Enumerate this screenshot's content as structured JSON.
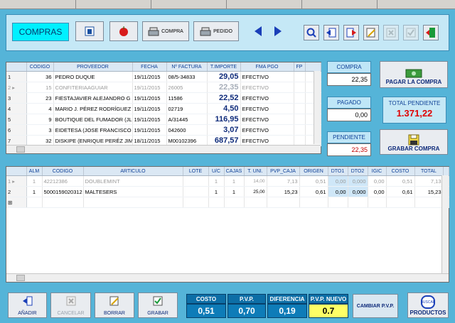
{
  "title": "COMPRAS",
  "toolbar": {
    "compra_label": "COMPRA",
    "pedido_label": "PEDIDO"
  },
  "purchases": {
    "headers": [
      "",
      "CODIGO",
      "PROVEEDOR",
      "FECHA",
      "Nº FACTURA",
      "T.IMPORTE",
      "FMA PGO",
      "FP"
    ],
    "rows": [
      {
        "n": "1",
        "codigo": "36",
        "proveedor": "PEDRO DUQUE",
        "fecha": "19/11/2015",
        "factura": "08/5-34833",
        "importe": "29,05",
        "pago": "EFECTIVO"
      },
      {
        "n": "2",
        "codigo": "15",
        "proveedor": "CONFITERIAAGUIAR",
        "fecha": "19/11/2015",
        "factura": "26005",
        "importe": "22,35",
        "pago": "EFECTIVO"
      },
      {
        "n": "3",
        "codigo": "23",
        "proveedor": "FIESTAJAVIER ALEJANDRO G",
        "fecha": "19/11/2015",
        "factura": "11586",
        "importe": "22,52",
        "pago": "EFECTIVO"
      },
      {
        "n": "4",
        "codigo": "4",
        "proveedor": "MARIO J. PÉREZ RODRÍGUEZ",
        "fecha": "19/11/2015",
        "factura": "02719",
        "importe": "4,50",
        "pago": "EFECTIVO"
      },
      {
        "n": "5",
        "codigo": "9",
        "proveedor": "BOUTIQUE DEL FUMADOR (JL",
        "fecha": "19/11/2015",
        "factura": "A/31445",
        "importe": "116,95",
        "pago": "EFECTIVO"
      },
      {
        "n": "6",
        "codigo": "3",
        "proveedor": "EIDETESA (JOSE FRANCISCO",
        "fecha": "19/11/2015",
        "factura": "042600",
        "importe": "3,07",
        "pago": "EFECTIVO"
      },
      {
        "n": "7",
        "codigo": "32",
        "proveedor": "DISKIPE (ENRIQUE PERÉZ JIM",
        "fecha": "18/11/2015",
        "factura": "M00102396",
        "importe": "687,57",
        "pago": "EFECTIVO"
      }
    ]
  },
  "summary": {
    "compra_label": "COMPRA",
    "compra_value": "22,35",
    "pagado_label": "PAGADO",
    "pagado_value": "0,00",
    "pendiente_label": "PENDIENTE",
    "pendiente_value": "22,35",
    "pagar_label": "PAGAR LA COMPRA",
    "total_pendiente_label": "TOTAL PENDIENTE",
    "total_pendiente_value": "1.371,22",
    "grabar_compra_label": "GRABAR COMPRA"
  },
  "lines": {
    "headers": [
      "",
      "ALM",
      "CODIGO",
      "ARTICULO",
      "LOTE",
      "U/C",
      "CAJAS",
      "T. UNI.",
      "PVP_CAJA",
      "ORIGEN",
      "DTO1",
      "DTO2",
      "IGIC",
      "COSTO",
      "TOTAL"
    ],
    "rows": [
      {
        "n": "1",
        "alm": "1",
        "codigo": "42212386",
        "articulo": "DOUBLEMINT",
        "lote": "",
        "uc": "1",
        "cajas": "1",
        "tuni": "14,00",
        "pvp": "7,13",
        "origen": "0,51",
        "dto1": "0,00",
        "dto2": "0,000",
        "igic": "0,00",
        "costo": "0,51",
        "total": "7,13"
      },
      {
        "n": "2",
        "alm": "1",
        "codigo": "5000159020312",
        "articulo": "MALTESERS",
        "lote": "",
        "uc": "1",
        "cajas": "1",
        "tuni": "25,00",
        "pvp": "15,23",
        "origen": "0,61",
        "dto1": "0,00",
        "dto2": "0,000",
        "igic": "0,00",
        "costo": "0,61",
        "total": "15,23"
      }
    ]
  },
  "bottom": {
    "anadir_label": "AÑADIR",
    "cancelar_label": "CANCELAR",
    "borrar_label": "BORRAR",
    "grabar_label": "GRABAR",
    "costo_label": "COSTO",
    "costo_value": "0,51",
    "pvp_label": "P.V.P.",
    "pvp_value": "0,70",
    "diferencia_label": "DIFERENCIA",
    "diferencia_value": "0,19",
    "pvp_nuevo_label": "P.V.P. NUEVO",
    "pvp_nuevo_value": "0.7",
    "cambiar_label": "CAMBIAR P.V.P.",
    "productos_label": "PRODUCTOS",
    "buscar_label": "BUSCAR"
  },
  "colors": {
    "background": "#55b4d8",
    "title_box": "#00f0ff",
    "total_pendiente": "#e00000",
    "pendiente_value": "#c00000"
  }
}
